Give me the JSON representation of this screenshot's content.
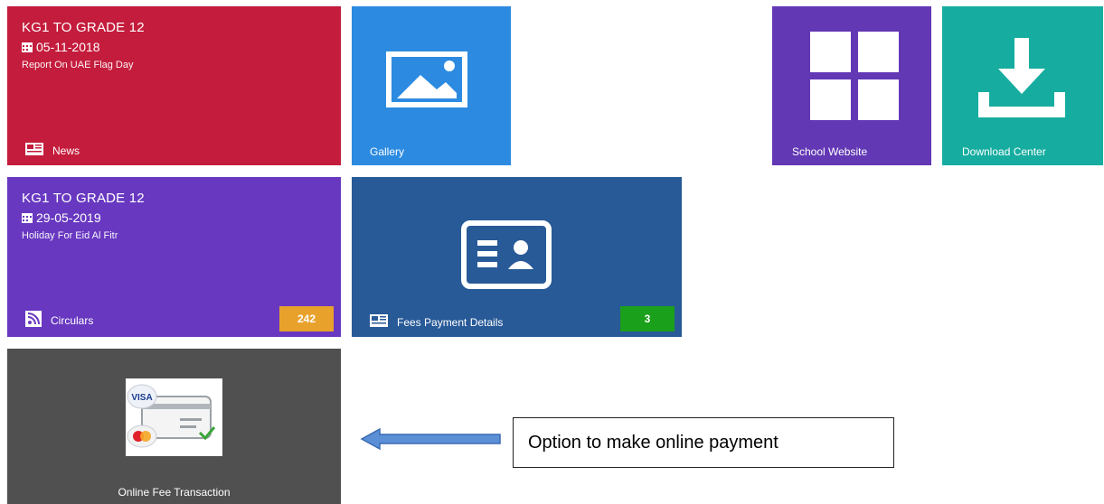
{
  "tiles": {
    "news": {
      "title": "KG1 TO GRADE 12",
      "date": "05-11-2018",
      "description": "Report On UAE Flag Day",
      "label": "News",
      "icon": "newspaper-icon",
      "color": "#c41c3c"
    },
    "gallery": {
      "label": "Gallery",
      "icon": "image-icon",
      "color": "#2c8be0"
    },
    "school_website": {
      "label": "School Website",
      "icon": "grid-icon",
      "color": "#6238b4"
    },
    "download_center": {
      "label": "Download Center",
      "icon": "download-icon",
      "color": "#16ada0"
    },
    "circulars": {
      "title": "KG1 TO GRADE 12",
      "date": "29-05-2019",
      "description": "Holiday For Eid Al Fitr",
      "label": "Circulars",
      "icon": "rss-icon",
      "count": "242",
      "badge_color": "#e8a22c",
      "color": "#6838c0"
    },
    "fees_payment": {
      "label": "Fees Payment Details",
      "icon": "id-card-icon",
      "count": "3",
      "badge_color": "#1aa01a",
      "color": "#285a98"
    },
    "online_fee": {
      "label": "Online Fee Transaction",
      "icon": "credit-card-payment-icon",
      "card_brand": "VISA",
      "color": "#505050"
    }
  },
  "annotation": {
    "text": "Option to make online payment",
    "arrow_icon": "left-arrow-icon"
  }
}
